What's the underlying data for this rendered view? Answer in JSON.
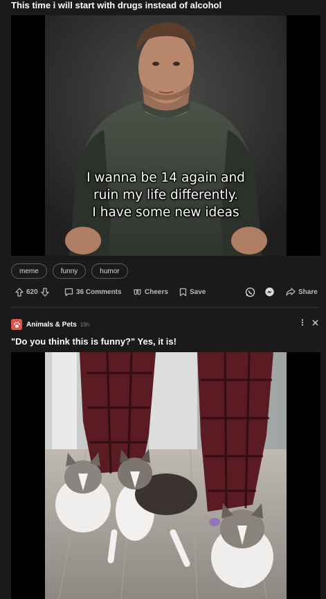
{
  "post1": {
    "title": "This time i will start with drugs instead of alcohol",
    "image_caption": [
      "I wanna be 14 again and",
      "ruin my life differently.",
      "I have some new ideas"
    ],
    "tags": [
      "meme",
      "funny",
      "humor"
    ],
    "vote_count": "620",
    "comments_label": "36 Comments",
    "cheers_label": "Cheers",
    "save_label": "Save",
    "share_label": "Share"
  },
  "post2": {
    "subreddit": "Animals & Pets",
    "age": "19h",
    "title": "\"Do you think this is funny?\" Yes, it is!"
  },
  "colors": {
    "background": "#1a1a1b",
    "subreddit_icon": "#e0534a",
    "messenger": "#2d88ff"
  },
  "icons": [
    "upvote-icon",
    "downvote-icon",
    "comment-icon",
    "cheers-icon",
    "save-icon",
    "whatsapp-icon",
    "messenger-icon",
    "share-icon",
    "paw-icon",
    "more-options-icon",
    "close-icon"
  ]
}
